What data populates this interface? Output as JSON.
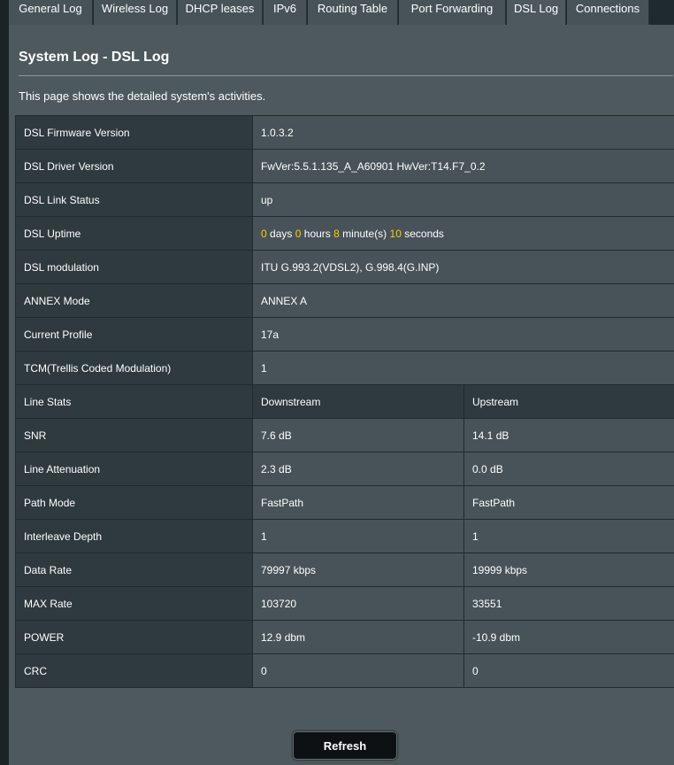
{
  "tabs": [
    {
      "label": "General Log"
    },
    {
      "label": "Wireless Log"
    },
    {
      "label": "DHCP leases"
    },
    {
      "label": "IPv6"
    },
    {
      "label": "Routing Table"
    },
    {
      "label": "Port Forwarding"
    },
    {
      "label": "DSL Log",
      "active": true
    },
    {
      "label": "Connections"
    }
  ],
  "page": {
    "title": "System Log - DSL Log",
    "description": "This page shows the detailed system's activities."
  },
  "info": [
    {
      "label": "DSL Firmware Version",
      "value": "1.0.3.2"
    },
    {
      "label": "DSL Driver Version",
      "value": "FwVer:5.5.1.135_A_A60901 HwVer:T14.F7_0.2"
    },
    {
      "label": "DSL Link Status",
      "value": "up"
    }
  ],
  "uptime": {
    "label": "DSL Uptime",
    "days": "0",
    "days_unit": "days",
    "hours": "0",
    "hours_unit": "hours",
    "minutes": "8",
    "minutes_unit": "minute(s)",
    "seconds": "10",
    "seconds_unit": "seconds"
  },
  "info2": [
    {
      "label": "DSL modulation",
      "value": "ITU G.993.2(VDSL2), G.998.4(G.INP)"
    },
    {
      "label": "ANNEX Mode",
      "value": "ANNEX A"
    },
    {
      "label": "Current Profile",
      "value": "17a"
    },
    {
      "label": "TCM(Trellis Coded Modulation)",
      "value": "1"
    }
  ],
  "stats_header": {
    "label": "Line Stats",
    "down": "Downstream",
    "up": "Upstream"
  },
  "stats": [
    {
      "label": "SNR",
      "down": "7.6 dB",
      "up": "14.1 dB"
    },
    {
      "label": "Line Attenuation",
      "down": "2.3 dB",
      "up": "0.0 dB"
    },
    {
      "label": "Path Mode",
      "down": "FastPath",
      "up": "FastPath"
    },
    {
      "label": "Interleave Depth",
      "down": "1",
      "up": "1"
    },
    {
      "label": "Data Rate",
      "down": "79997 kbps",
      "up": "19999 kbps"
    },
    {
      "label": "MAX Rate",
      "down": "103720",
      "up": "33551"
    },
    {
      "label": "POWER",
      "down": "12.9 dbm",
      "up": "-10.9 dbm"
    },
    {
      "label": "CRC",
      "down": "0",
      "up": "0"
    }
  ],
  "buttons": {
    "refresh": "Refresh"
  },
  "colors": {
    "background": "#4d595d",
    "highlight_number": "#ffcc00"
  }
}
